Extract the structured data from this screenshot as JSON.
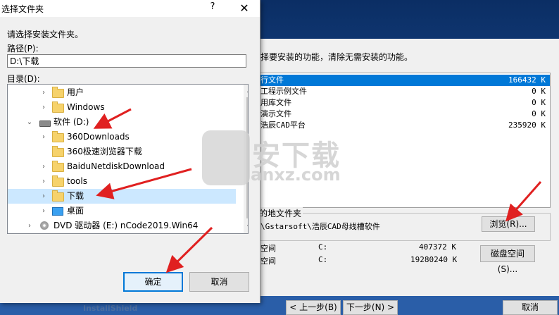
{
  "installer": {
    "description": "择要安装的功能，清除无需安装的功能。",
    "features": [
      {
        "name": "行文件",
        "size": "166432 K",
        "selected": true
      },
      {
        "name": "工程示例文件",
        "size": "0 K",
        "selected": false
      },
      {
        "name": "用库文件",
        "size": "0 K",
        "selected": false
      },
      {
        "name": "演示文件",
        "size": "0 K",
        "selected": false
      },
      {
        "name": "浩辰CAD平台",
        "size": "235920 K",
        "selected": false
      }
    ],
    "dest_label": "的地文件夹",
    "dest_path": "\\Gstarsoft\\浩辰CAD母线槽软件",
    "browse_label": "浏览(R)...",
    "space_rows": [
      {
        "label": "空间",
        "drive": "C:",
        "value": "407372 K"
      },
      {
        "label": "空间",
        "drive": "C:",
        "value": "19280240 K"
      }
    ],
    "disk_space_label": "磁盘空间(S)...",
    "brand": "InstallShield",
    "back_label": "< 上一步(B)",
    "next_label": "下一步(N) >",
    "cancel_label": "取消"
  },
  "dialog": {
    "title": "选择文件夹",
    "help": "?",
    "close": "✕",
    "prompt": "请选择安装文件夹。",
    "path_label": "路径(P):",
    "path_value": "D:\\下载",
    "dir_label": "目录(D):",
    "tree": [
      {
        "label": "用户",
        "icon": "folder",
        "chevron": "›"
      },
      {
        "label": "Windows",
        "icon": "folder",
        "chevron": "›"
      },
      {
        "label": "软件 (D:)",
        "icon": "drive",
        "chevron": "⌄"
      },
      {
        "label": "360Downloads",
        "icon": "folder",
        "chevron": "›"
      },
      {
        "label": "360极速浏览器下载",
        "icon": "folder",
        "chevron": ""
      },
      {
        "label": "BaiduNetdiskDownload",
        "icon": "folder",
        "chevron": "›"
      },
      {
        "label": "tools",
        "icon": "folder",
        "chevron": "›"
      },
      {
        "label": "下载",
        "icon": "folder",
        "chevron": "›",
        "selected": true
      },
      {
        "label": "桌面",
        "icon": "desktop",
        "chevron": "›"
      },
      {
        "label": "DVD 驱动器 (E:) nCode2019.Win64",
        "icon": "dvd",
        "chevron": "›"
      }
    ],
    "ok_label": "确定",
    "cancel_label": "取消"
  },
  "watermark": {
    "text": "安下载",
    "url": "anxz.com"
  },
  "colors": {
    "accent": "#0078d7",
    "arrow": "#e02020",
    "selection": "#cce8ff"
  }
}
